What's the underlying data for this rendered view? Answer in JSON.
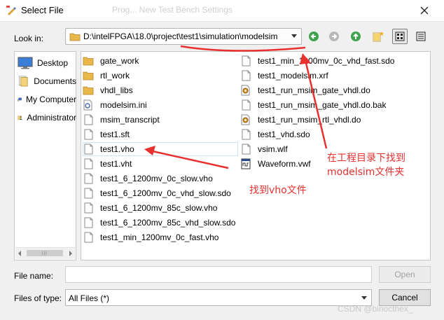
{
  "window": {
    "title": "Select File",
    "ghost_title": "Prog... New Test Bench Settings",
    "close_icon": "close-icon"
  },
  "toolbar": {
    "look_in_label": "Look in:",
    "path": "D:\\intelFPGA\\18.0\\project\\test1\\simulation\\modelsim",
    "icons": [
      "back-icon",
      "forward-icon",
      "parent-folder-icon",
      "new-folder-icon",
      "list-view-icon",
      "detail-view-icon"
    ]
  },
  "sidebar": {
    "items": [
      {
        "label": "Desktop",
        "icon": "desktop-icon"
      },
      {
        "label": "Documents",
        "icon": "documents-icon"
      },
      {
        "label": "My Computer",
        "icon": "computer-icon"
      },
      {
        "label": "Administrator",
        "icon": "user-icon"
      }
    ]
  },
  "files": {
    "col1": [
      {
        "name": "gate_work",
        "icon": "folder"
      },
      {
        "name": "rtl_work",
        "icon": "folder"
      },
      {
        "name": "vhdl_libs",
        "icon": "folder"
      },
      {
        "name": "modelsim.ini",
        "icon": "settings"
      },
      {
        "name": "msim_transcript",
        "icon": "doc"
      },
      {
        "name": "test1.sft",
        "icon": "doc"
      },
      {
        "name": "test1.vho",
        "icon": "doc",
        "selected": true
      },
      {
        "name": "test1.vht",
        "icon": "doc"
      },
      {
        "name": "test1_6_1200mv_0c_slow.vho",
        "icon": "doc"
      },
      {
        "name": "test1_6_1200mv_0c_vhd_slow.sdo",
        "icon": "doc"
      },
      {
        "name": "test1_6_1200mv_85c_slow.vho",
        "icon": "doc"
      },
      {
        "name": "test1_6_1200mv_85c_vhd_slow.sdo",
        "icon": "doc"
      },
      {
        "name": "test1_min_1200mv_0c_fast.vho",
        "icon": "doc"
      }
    ],
    "col2": [
      {
        "name": "test1_min_1200mv_0c_vhd_fast.sdo",
        "icon": "doc"
      },
      {
        "name": "test1_modelsim.xrf",
        "icon": "doc"
      },
      {
        "name": "test1_run_msim_gate_vhdl.do",
        "icon": "gear"
      },
      {
        "name": "test1_run_msim_gate_vhdl.do.bak",
        "icon": "doc"
      },
      {
        "name": "test1_run_msim_rtl_vhdl.do",
        "icon": "gear"
      },
      {
        "name": "test1_vhd.sdo",
        "icon": "doc"
      },
      {
        "name": "vsim.wlf",
        "icon": "doc"
      },
      {
        "name": "Waveform.vwf",
        "icon": "wave"
      }
    ]
  },
  "bottom": {
    "file_name_label": "File name:",
    "file_name_value": "",
    "open_label": "Open",
    "files_of_type_label": "Files of type:",
    "files_of_type_value": "All Files (*)",
    "cancel_label": "Cancel"
  },
  "annotations": {
    "find_vho": "找到vho文件",
    "find_modelsim_line1": "在工程目录下找到",
    "find_modelsim_line2": "modelsim文件夹",
    "color": "#e8302f"
  },
  "watermark": "CSDN @binocthex_"
}
